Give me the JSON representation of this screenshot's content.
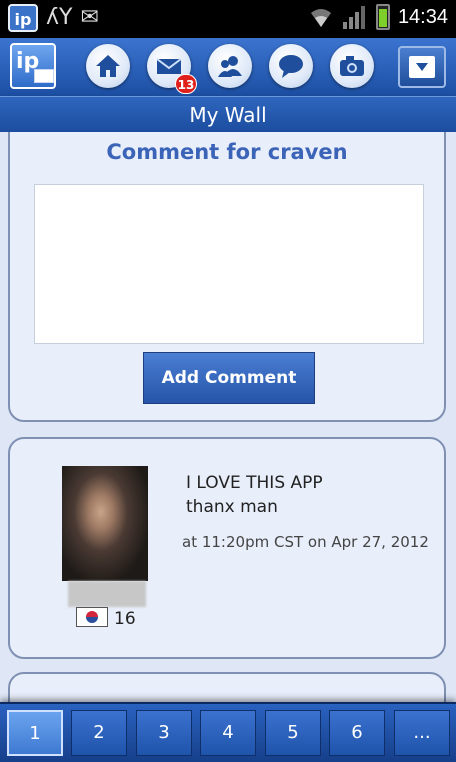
{
  "status_bar": {
    "clock": "14:34",
    "app_icon_text": "ip",
    "signal_glyph": "ʎY",
    "mail_glyph": "✉"
  },
  "nav": {
    "logo_text": "ip",
    "mail_badge": "13",
    "icons": [
      "home-icon",
      "mail-icon",
      "friends-icon",
      "chat-icon",
      "camera-icon",
      "dropdown-icon"
    ]
  },
  "title_bar": {
    "title": "My Wall"
  },
  "comment_form": {
    "heading": "Comment for craven",
    "input_value": "",
    "submit_label": "Add Comment"
  },
  "post": {
    "lines": [
      "I LOVE THIS APP",
      "thanx man"
    ],
    "timestamp": "at 11:20pm  CST on Apr 27, 2012",
    "flag_count": "16"
  },
  "pager": {
    "pages": [
      "1",
      "2",
      "3",
      "4",
      "5",
      "6",
      "..."
    ],
    "active_index": 0
  },
  "colors": {
    "accent": "#2f66be",
    "heading": "#3b63b7",
    "badge": "#e0211b"
  }
}
